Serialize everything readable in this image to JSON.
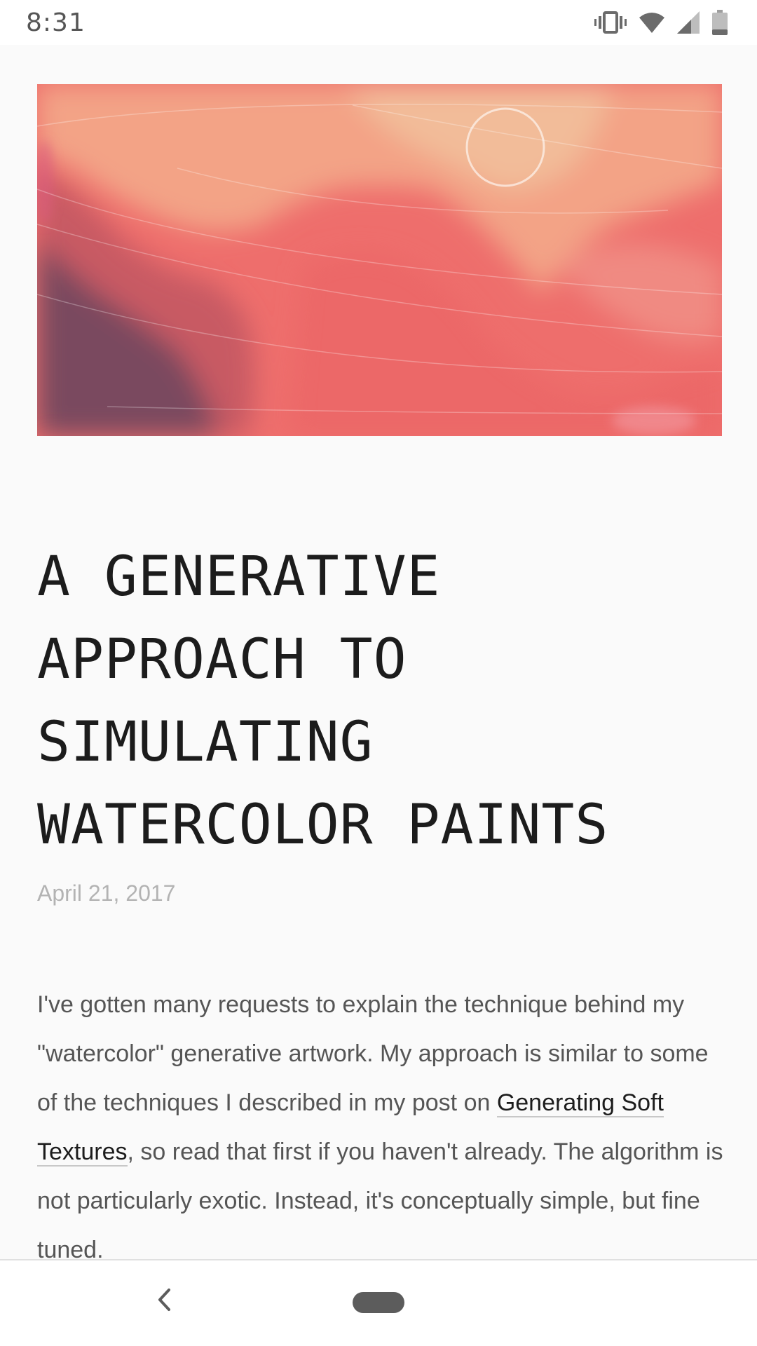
{
  "status_bar": {
    "time": "8:31",
    "icons": [
      "vibrate-icon",
      "wifi-icon",
      "signal-icon",
      "battery-icon"
    ]
  },
  "hero": {
    "image": "watercolor-painting",
    "colors": {
      "base": "#ee6e6c",
      "peach": "#f1b391",
      "coral": "#f08c80",
      "plum": "#7a4a5e",
      "deep_red": "#d8505a"
    }
  },
  "article": {
    "title_lines": [
      "A GENERATIVE",
      "APPROACH TO",
      "SIMULATING",
      "WATERCOLOR PAINTS"
    ],
    "date": "April 21, 2017",
    "body": {
      "before_link": "I've gotten many requests to explain the technique behind my \"watercolor\" generative artwork. My approach is similar to some of the techniques I described in my post on ",
      "link_text": "Generating Soft Textures",
      "after_link": ", so read that first if you haven't already. The algorithm is not particularly exotic. Instead, it's conceptually simple, but fine tuned."
    }
  },
  "nav_bar": {
    "icons": [
      "back-chevron-icon",
      "home-pill"
    ]
  },
  "colors": {
    "background": "#fafafa",
    "title": "#1c1c1c",
    "body_text": "#555555",
    "date": "#b3b3b3"
  }
}
